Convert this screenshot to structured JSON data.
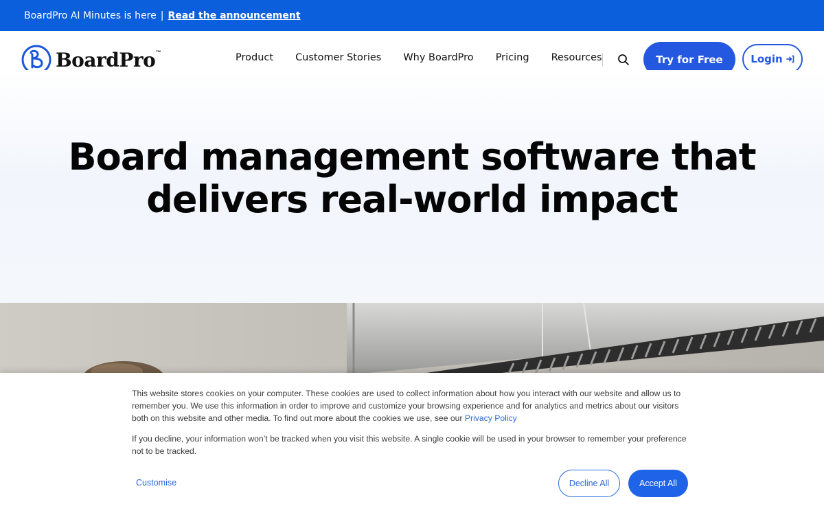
{
  "announcement": {
    "text": "BoardPro AI Minutes is here",
    "separator": "|",
    "link": "Read the announcement"
  },
  "brand": {
    "name": "BoardPro",
    "trademark": "™",
    "color": "#1b56d8"
  },
  "nav": {
    "items": [
      {
        "label": "Product"
      },
      {
        "label": "Customer Stories"
      },
      {
        "label": "Why BoardPro"
      },
      {
        "label": "Pricing"
      },
      {
        "label": "Resources"
      }
    ],
    "search_icon": "search-icon",
    "try_label": "Try for Free",
    "login_label": "Login",
    "login_icon": "sign-in-icon",
    "accent": "#2558e0"
  },
  "hero": {
    "title_line1": "Board management software that",
    "title_line2": "delivers real-world impact"
  },
  "cookie": {
    "paragraph1": "This website stores cookies on your computer. These cookies are used to collect information about how you interact with our website and allow us to remember you. We use this information in order to improve and customize your browsing experience and for analytics and metrics about our visitors both on this website and other media. To find out more about the cookies we use, see our",
    "privacy_link": "Privacy Policy",
    "paragraph2": "If you decline, your information won’t be tracked when you visit this website. A single cookie will be used in your browser to remember your preference not to be tracked.",
    "customise_label": "Customise",
    "decline_label": "Decline All",
    "accept_label": "Accept All"
  }
}
